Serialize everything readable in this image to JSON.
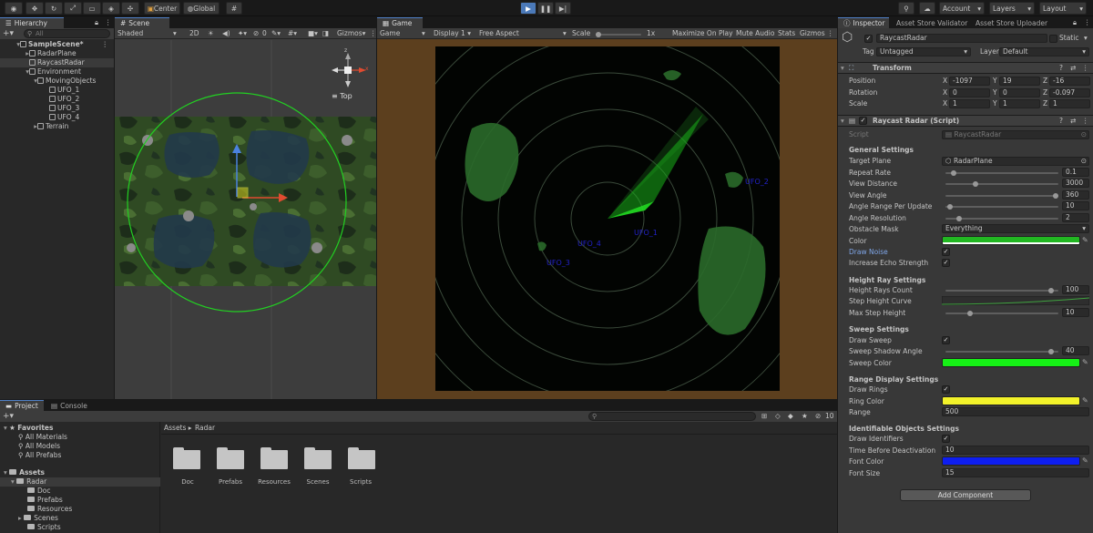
{
  "toolbar": {
    "center_label": "Center",
    "global_label": "Global",
    "account_label": "Account",
    "layers_label": "Layers",
    "layout_label": "Layout"
  },
  "hierarchy": {
    "tab_label": "Hierarchy",
    "search_placeholder": "All",
    "items": [
      {
        "label": "SampleScene*"
      },
      {
        "label": "RadarPlane"
      },
      {
        "label": "RaycastRadar"
      },
      {
        "label": "Environment"
      },
      {
        "label": "MovingObjects"
      },
      {
        "label": "UFO_1"
      },
      {
        "label": "UFO_2"
      },
      {
        "label": "UFO_3"
      },
      {
        "label": "UFO_4"
      },
      {
        "label": "Terrain"
      }
    ]
  },
  "scene": {
    "tab_label": "Scene",
    "shading": "Shaded",
    "mode_2d": "2D",
    "hidden_count": "0",
    "gizmos": "Gizmos",
    "view_label": "Top",
    "axis_y": "y",
    "axis_x": "x",
    "axis_z": "z"
  },
  "game": {
    "tab_label": "Game",
    "display_mode": "Game",
    "display": "Display 1",
    "aspect": "Free Aspect",
    "scale_label": "Scale",
    "scale_value": "1x",
    "maximize": "Maximize On Play",
    "mute": "Mute Audio",
    "stats": "Stats",
    "gizmos": "Gizmos",
    "ufo_labels": [
      "UFO_2",
      "UFO_1",
      "UFO_4",
      "UFO_3"
    ]
  },
  "inspector": {
    "tabs": [
      "Inspector",
      "Asset Store Validator",
      "Asset Store Uploader"
    ],
    "object_name": "RaycastRadar",
    "static_label": "Static",
    "tag_label": "Tag",
    "tag_value": "Untagged",
    "layer_label": "Layer",
    "layer_value": "Default",
    "transform_title": "Transform",
    "position_label": "Position",
    "rotation_label": "Rotation",
    "scale_label": "Scale",
    "position": [
      "-1097",
      "19",
      "-16"
    ],
    "rotation": [
      "0",
      "0",
      "-0.097"
    ],
    "scale": [
      "1",
      "1",
      "1"
    ],
    "axis_x": "X",
    "axis_y": "Y",
    "axis_z": "Z",
    "script_component_title": "Raycast Radar (Script)",
    "script_label": "Script",
    "script_value": "RaycastRadar",
    "general_title": "General Settings",
    "target_plane_label": "Target Plane",
    "target_plane_value": "RadarPlane",
    "repeat_rate_label": "Repeat Rate",
    "repeat_rate": "0.1",
    "view_distance_label": "View Distance",
    "view_distance": "3000",
    "view_angle_label": "View Angle",
    "view_angle": "360",
    "angle_range_label": "Angle Range Per Update",
    "angle_range": "10",
    "angle_resolution_label": "Angle Resolution",
    "angle_resolution": "2",
    "obstacle_mask_label": "Obstacle Mask",
    "obstacle_mask": "Everything",
    "color_label": "Color",
    "draw_noise_label": "Draw Noise",
    "increase_echo_label": "Increase Echo Strength",
    "height_title": "Height Ray Settings",
    "height_rays_label": "Height Rays Count",
    "height_rays": "100",
    "step_height_curve_label": "Step Height Curve",
    "max_step_label": "Max Step Height",
    "max_step": "10",
    "sweep_title": "Sweep Settings",
    "draw_sweep_label": "Draw Sweep",
    "sweep_shadow_label": "Sweep Shadow Angle",
    "sweep_shadow": "40",
    "sweep_color_label": "Sweep Color",
    "range_title": "Range Display Settings",
    "draw_rings_label": "Draw Rings",
    "ring_color_label": "Ring Color",
    "range_label": "Range",
    "range": "500",
    "ident_title": "Identifiable Objects Settings",
    "draw_identifiers_label": "Draw Identifiers",
    "time_before_label": "Time Before Deactivation",
    "time_before": "10",
    "font_color_label": "Font Color",
    "font_size_label": "Font Size",
    "font_size": "15",
    "add_component": "Add Component",
    "colors": {
      "color": "#22b722",
      "sweep_color": "#16f016",
      "ring_color": "#f2f22a",
      "font_color": "#0e1ef0"
    },
    "slider_levels": {
      "repeat_rate": 0.05,
      "view_distance": 0.25,
      "view_angle": 1.0,
      "angle_range": 0.02,
      "angle_resolution": 0.1,
      "height_rays": 0.96,
      "max_step": 0.2,
      "sweep_shadow": 0.96
    }
  },
  "project": {
    "tabs": [
      "Project",
      "Console"
    ],
    "favorites_label": "Favorites",
    "favorites": [
      "All Materials",
      "All Models",
      "All Prefabs"
    ],
    "assets_label": "Assets",
    "tree": [
      "Radar",
      "Doc",
      "Prefabs",
      "Resources",
      "Scenes",
      "Scripts"
    ],
    "breadcrumb_root": "Assets",
    "breadcrumb_child": "Radar",
    "hidden_count": "10",
    "folders": [
      "Doc",
      "Prefabs",
      "Resources",
      "Scenes",
      "Scripts"
    ]
  }
}
